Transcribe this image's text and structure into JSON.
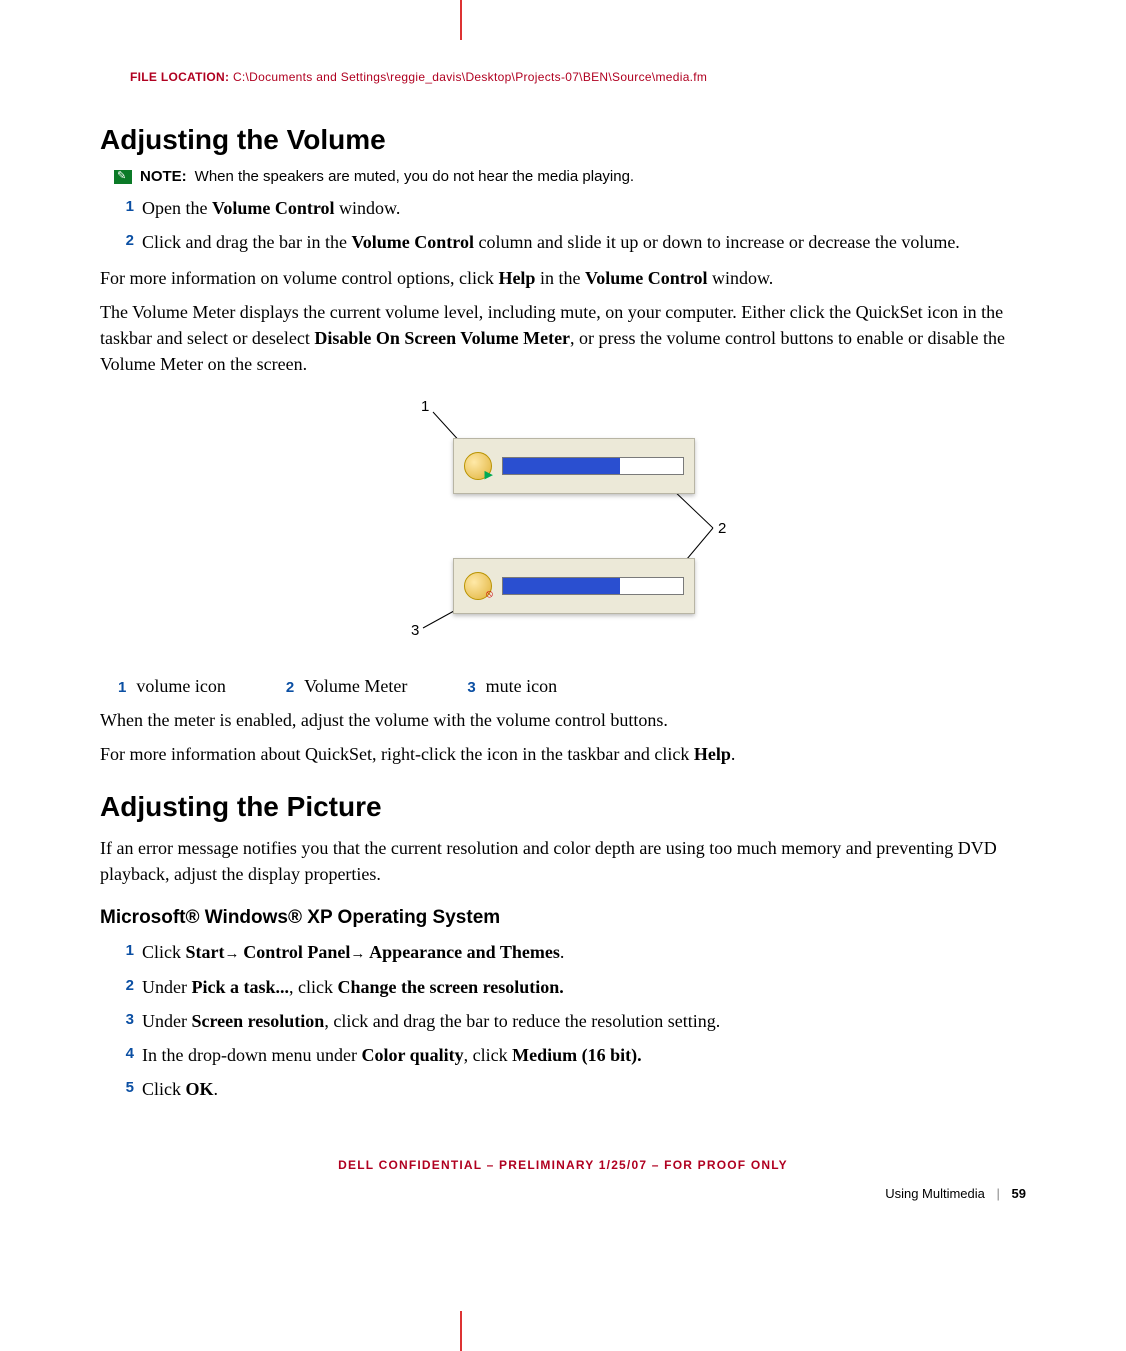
{
  "header": {
    "file_location_label": "FILE LOCATION:",
    "file_location_path": "C:\\Documents and Settings\\reggie_davis\\Desktop\\Projects-07\\BEN\\Source\\media.fm"
  },
  "section1": {
    "title": "Adjusting the Volume",
    "note_label": "NOTE:",
    "note_text": "When the speakers are muted, you do not hear the media playing.",
    "steps": [
      {
        "pre": "Open the ",
        "bold": "Volume Control",
        "post": " window."
      },
      {
        "pre": "Click and drag the bar in the ",
        "bold": "Volume Control",
        "post": " column and slide it up or down to increase or decrease the volume."
      }
    ],
    "para1": {
      "pre": "For more information on volume control options, click ",
      "b1": "Help",
      "mid": " in the ",
      "b2": "Volume Control",
      "post": " window."
    },
    "para2": {
      "pre": "The Volume Meter displays the current volume level, including mute, on your computer. Either click the QuickSet icon in the taskbar and select or deselect ",
      "b1": "Disable On Screen Volume Meter",
      "post": ", or press the volume control buttons to enable or disable the Volume Meter on the screen."
    },
    "figure": {
      "callouts": {
        "c1": "1",
        "c2": "2",
        "c3": "3"
      },
      "legend": [
        {
          "num": "1",
          "label": "volume icon"
        },
        {
          "num": "2",
          "label": "Volume Meter"
        },
        {
          "num": "3",
          "label": "mute icon"
        }
      ],
      "icons": {
        "top": "volume-icon",
        "bottom": "mute-icon"
      }
    },
    "para3": "When the meter is enabled, adjust the volume with the volume control buttons.",
    "para4": {
      "pre": "For more information about QuickSet, right-click the icon in the taskbar and click ",
      "b1": "Help",
      "post": "."
    }
  },
  "section2": {
    "title": "Adjusting the Picture",
    "para1": "If an error message notifies you that the current resolution and color depth are using too much memory and preventing DVD playback, adjust the display properties.",
    "subhead": "Microsoft® Windows® XP Operating System",
    "steps": [
      {
        "segments": [
          {
            "t": "Click "
          },
          {
            "t": "Start",
            "b": true
          },
          {
            "t": "→ ",
            "a": true
          },
          {
            "t": "Control Panel",
            "b": true
          },
          {
            "t": "→ ",
            "a": true
          },
          {
            "t": "Appearance and Themes",
            "b": true
          },
          {
            "t": "."
          }
        ]
      },
      {
        "segments": [
          {
            "t": "Under "
          },
          {
            "t": "Pick a task...",
            "b": true
          },
          {
            "t": ", click "
          },
          {
            "t": "Change the screen resolution.",
            "b": true
          }
        ]
      },
      {
        "segments": [
          {
            "t": "Under "
          },
          {
            "t": "Screen resolution",
            "b": true
          },
          {
            "t": ", click and drag the bar to reduce the resolution setting."
          }
        ]
      },
      {
        "segments": [
          {
            "t": "In the drop-down menu under "
          },
          {
            "t": "Color quality",
            "b": true
          },
          {
            "t": ", click "
          },
          {
            "t": "Medium (16 bit).",
            "b": true
          }
        ]
      },
      {
        "segments": [
          {
            "t": "Click "
          },
          {
            "t": "OK",
            "b": true
          },
          {
            "t": "."
          }
        ]
      }
    ]
  },
  "footer": {
    "confidential": "DELL CONFIDENTIAL – PRELIMINARY 1/25/07 – FOR PROOF ONLY",
    "section_name": "Using Multimedia",
    "page_number": "59"
  }
}
